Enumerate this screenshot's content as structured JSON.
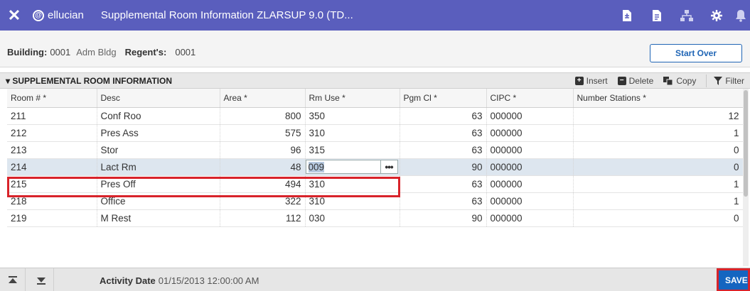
{
  "header": {
    "close_icon": "close-icon",
    "brand": "ellucian",
    "title": "Supplemental Room Information ZLARSUP 9.0 (TD...",
    "icons": [
      "document-icon",
      "report-icon",
      "related-icon",
      "tools-icon",
      "notification-icon"
    ]
  },
  "keyblock": {
    "building_label": "Building:",
    "building_value": "0001",
    "building_desc": "Adm Bldg",
    "regent_label": "Regent's:",
    "regent_value": "0001",
    "start_over": "Start Over"
  },
  "section": {
    "title": "▾ SUPPLEMENTAL ROOM INFORMATION",
    "insert": "Insert",
    "delete": "Delete",
    "copy": "Copy",
    "filter": "Filter"
  },
  "table": {
    "columns": [
      "Room # *",
      "Desc",
      "Area *",
      "Rm Use *",
      "Pgm Cl *",
      "CIPC *",
      "Number Stations *"
    ],
    "rows": [
      {
        "room": "211",
        "desc": "Conf Roo",
        "area": "800",
        "rm_use": "350",
        "pgm": "63",
        "cipc": "000000",
        "stations": "12"
      },
      {
        "room": "212",
        "desc": "Pres Ass",
        "area": "575",
        "rm_use": "310",
        "pgm": "63",
        "cipc": "000000",
        "stations": "1"
      },
      {
        "room": "213",
        "desc": "Stor",
        "area": "96",
        "rm_use": "315",
        "pgm": "63",
        "cipc": "000000",
        "stations": "0"
      },
      {
        "room": "214",
        "desc": "Lact Rm",
        "area": "48",
        "rm_use": "009",
        "pgm": "90",
        "cipc": "000000",
        "stations": "0"
      },
      {
        "room": "215",
        "desc": "Pres Off",
        "area": "494",
        "rm_use": "310",
        "pgm": "63",
        "cipc": "000000",
        "stations": "1"
      },
      {
        "room": "218",
        "desc": "Office",
        "area": "322",
        "rm_use": "310",
        "pgm": "63",
        "cipc": "000000",
        "stations": "1"
      },
      {
        "room": "219",
        "desc": "M Rest",
        "area": "112",
        "rm_use": "030",
        "pgm": "90",
        "cipc": "000000",
        "stations": "0"
      }
    ],
    "lookup_dots": "•••"
  },
  "footer": {
    "activity_label": "Activity Date",
    "activity_value": "01/15/2013 12:00:00 AM",
    "save": "SAVE"
  },
  "colors": {
    "header_bg": "#5a5ebd",
    "highlight": "#d8232a",
    "save_bg": "#1565c0",
    "selected_row": "#dde6ef"
  }
}
